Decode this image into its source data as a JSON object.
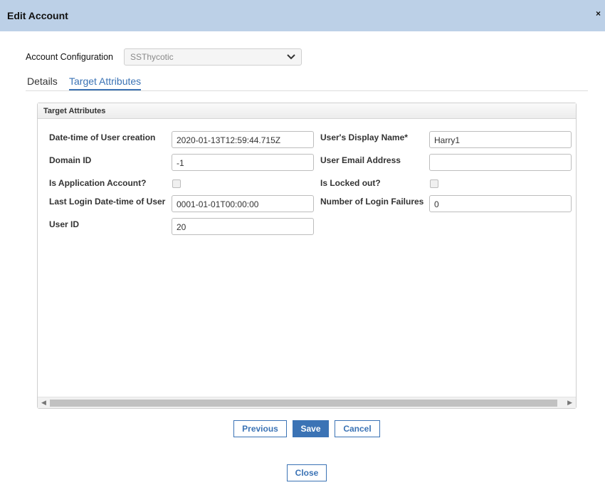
{
  "dialog": {
    "title": "Edit Account",
    "close_glyph": "×"
  },
  "account_config": {
    "label": "Account Configuration",
    "selected": "SSThycotic"
  },
  "tabs": [
    {
      "label": "Details",
      "active": false
    },
    {
      "label": "Target Attributes",
      "active": true
    }
  ],
  "panel": {
    "title": "Target Attributes",
    "fields": {
      "created_label": "Date-time of User creation",
      "created_value": "2020-01-13T12:59:44.715Z",
      "domain_label": "Domain ID",
      "domain_value": "-1",
      "is_app_label": "Is Application Account?",
      "is_app_checked": false,
      "last_login_label": "Last Login Date-time of User",
      "last_login_value": "0001-01-01T00:00:00",
      "user_id_label": "User ID",
      "user_id_value": "20",
      "display_name_label": "User's Display Name*",
      "display_name_value": "Harry1",
      "email_label": "User Email Address",
      "email_value": "",
      "locked_label": "Is Locked out?",
      "locked_checked": false,
      "failures_label": "Number of Login Failures",
      "failures_value": "0"
    }
  },
  "buttons": {
    "previous": "Previous",
    "save": "Save",
    "cancel": "Cancel",
    "close": "Close"
  },
  "colors": {
    "titlebar": "#bcd0e7",
    "accent": "#3b73b5"
  },
  "icons": {
    "dropdown": "chevron-down-icon",
    "close": "close-icon",
    "scroll_left": "scroll-left-icon",
    "scroll_right": "scroll-right-icon"
  }
}
